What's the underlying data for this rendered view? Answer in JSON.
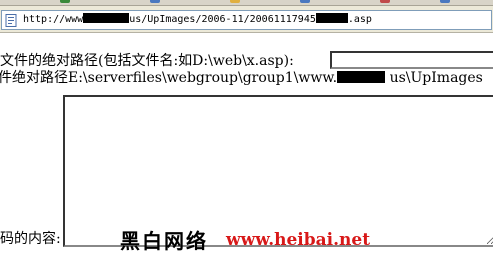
{
  "browser": {
    "address": {
      "url_prefix": "http://www",
      "url_middle": "us/UpImages/2006-11/20061117945",
      "url_suffix": ".asp"
    }
  },
  "form": {
    "path_label": "文件的绝对路径(包括文件名:如D:\\web\\x.asp):",
    "path_value": "",
    "server_path_prefix": "件绝对路径E:\\serverfiles\\webgroup\\group1\\www.",
    "server_path_suffix": "us\\UpImages",
    "content_label": "码的内容:",
    "content_value": ""
  },
  "watermark": {
    "chinese": "黑白网络",
    "url": "www.heibai.net"
  }
}
